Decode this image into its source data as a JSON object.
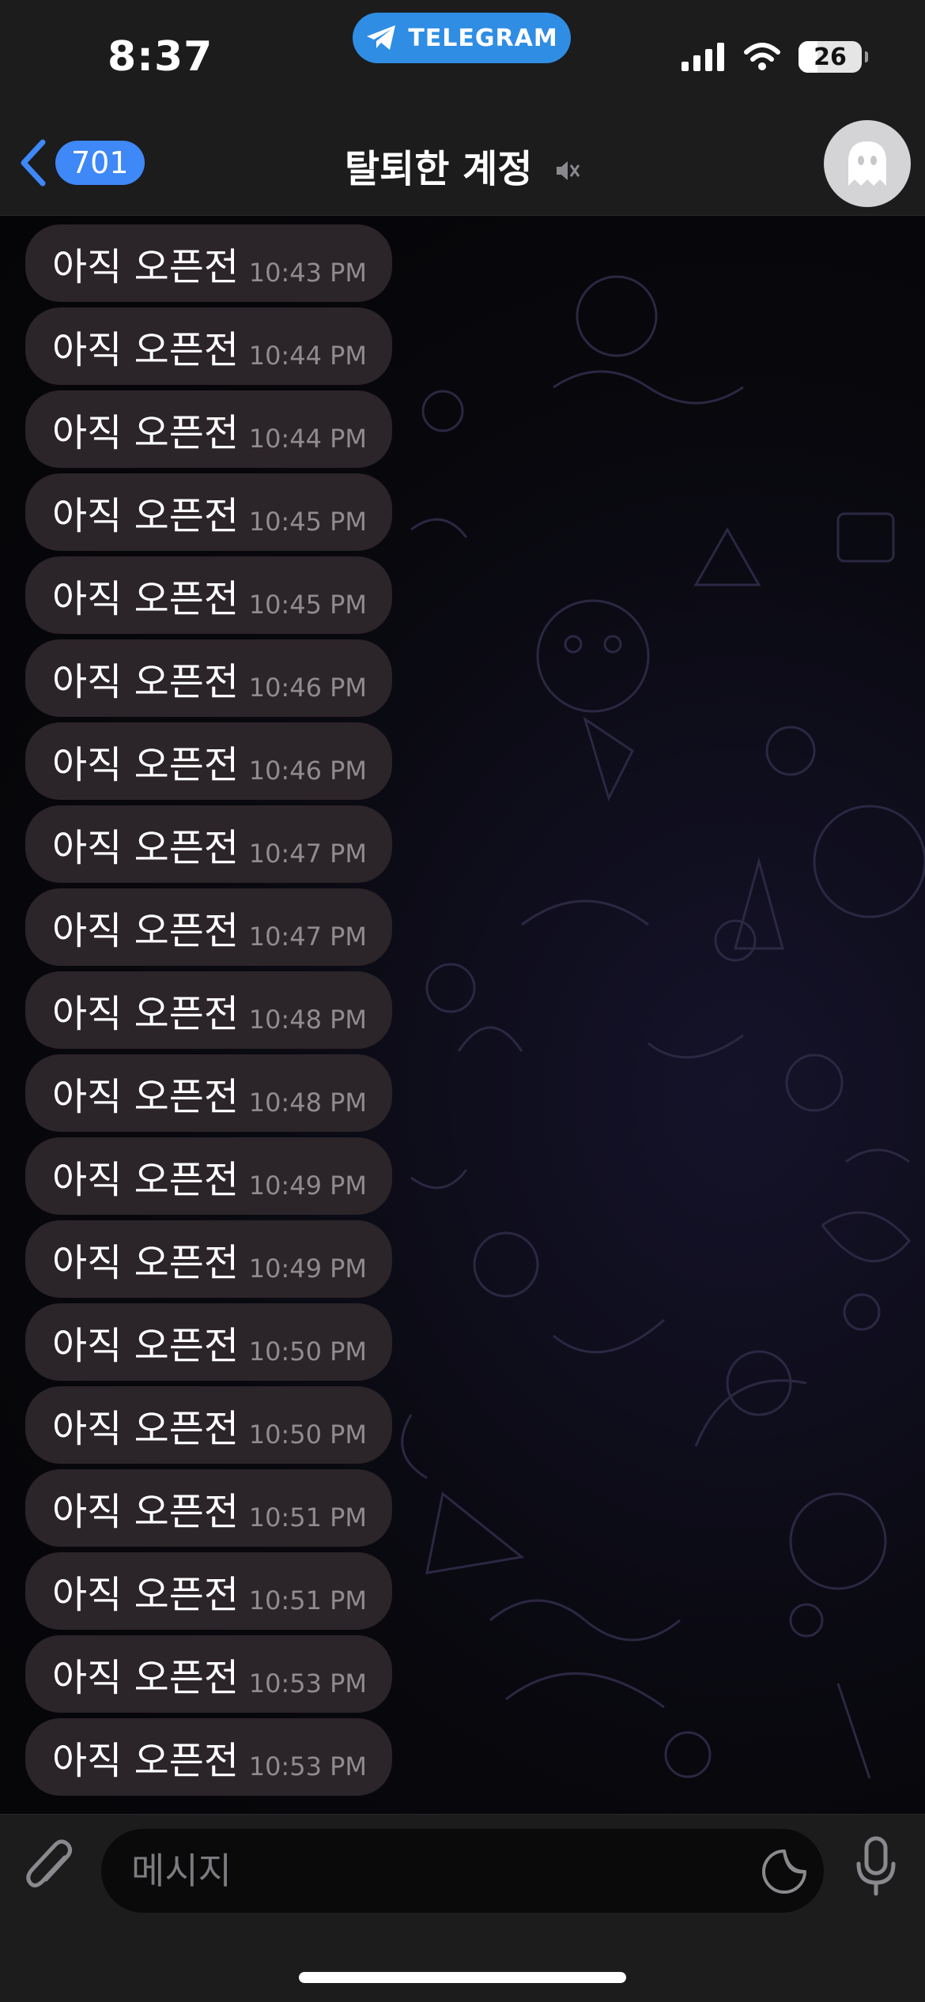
{
  "status_bar": {
    "time": "8:37",
    "app_pill": "TELEGRAM",
    "battery": "26"
  },
  "header": {
    "back_count": "701",
    "title": "탈퇴한 계정"
  },
  "messages": [
    {
      "text": "아직 오픈전",
      "time": "10:43 PM"
    },
    {
      "text": "아직 오픈전",
      "time": "10:44 PM"
    },
    {
      "text": "아직 오픈전",
      "time": "10:44 PM"
    },
    {
      "text": "아직 오픈전",
      "time": "10:45 PM"
    },
    {
      "text": "아직 오픈전",
      "time": "10:45 PM"
    },
    {
      "text": "아직 오픈전",
      "time": "10:46 PM"
    },
    {
      "text": "아직 오픈전",
      "time": "10:46 PM"
    },
    {
      "text": "아직 오픈전",
      "time": "10:47 PM"
    },
    {
      "text": "아직 오픈전",
      "time": "10:47 PM"
    },
    {
      "text": "아직 오픈전",
      "time": "10:48 PM"
    },
    {
      "text": "아직 오픈전",
      "time": "10:48 PM"
    },
    {
      "text": "아직 오픈전",
      "time": "10:49 PM"
    },
    {
      "text": "아직 오픈전",
      "time": "10:49 PM"
    },
    {
      "text": "아직 오픈전",
      "time": "10:50 PM"
    },
    {
      "text": "아직 오픈전",
      "time": "10:50 PM"
    },
    {
      "text": "아직 오픈전",
      "time": "10:51 PM"
    },
    {
      "text": "아직 오픈전",
      "time": "10:51 PM"
    },
    {
      "text": "아직 오픈전",
      "time": "10:53 PM"
    },
    {
      "text": "아직 오픈전",
      "time": "10:53 PM"
    }
  ],
  "composer": {
    "placeholder": "메시지"
  },
  "colors": {
    "bar_bg": "#1c1c1d",
    "accent": "#3e88f7",
    "bubble": "#2b2428",
    "timestamp": "#8f8c8e"
  }
}
